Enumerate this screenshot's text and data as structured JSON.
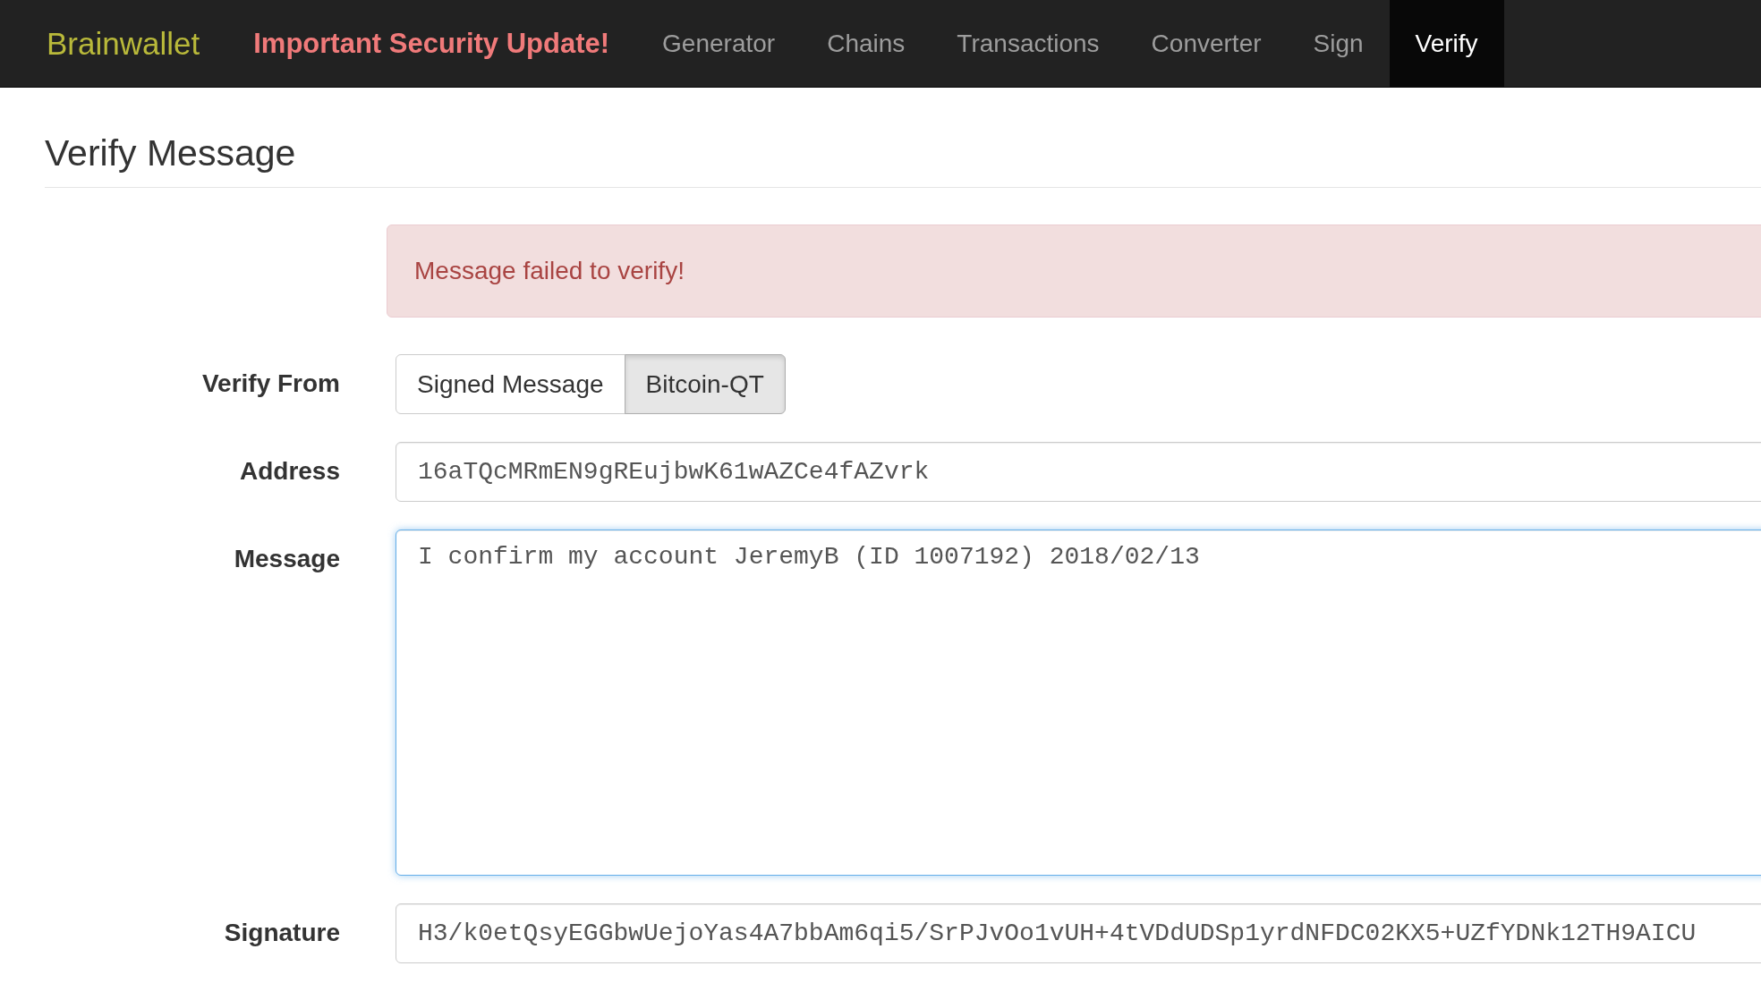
{
  "navbar": {
    "brand": "Brainwallet",
    "notice": "Important Security Update!",
    "items": [
      {
        "label": "Generator",
        "selected": false
      },
      {
        "label": "Chains",
        "selected": false
      },
      {
        "label": "Transactions",
        "selected": false
      },
      {
        "label": "Converter",
        "selected": false
      },
      {
        "label": "Sign",
        "selected": false
      },
      {
        "label": "Verify",
        "selected": true
      }
    ]
  },
  "heading": "Verify Message",
  "alert": {
    "text": "Message failed to verify!"
  },
  "form": {
    "verify_from": {
      "label": "Verify From",
      "options": [
        {
          "label": "Signed Message",
          "selected": false
        },
        {
          "label": "Bitcoin-QT",
          "selected": true
        }
      ]
    },
    "address": {
      "label": "Address",
      "value": "16aTQcMRmEN9gREujbwK61wAZCe4fAZvrk"
    },
    "message": {
      "label": "Message",
      "value": "I confirm my account JeremyB (ID 1007192) 2018/02/13",
      "focused": true
    },
    "signature": {
      "label": "Signature",
      "value": "H3/k0etQsyEGGbwUejoYas4A7bbAm6qi5/SrPJvOo1vUH+4tVDdUDSp1yrdNFDC02KX5+UZfYDNk12TH9AICU"
    }
  }
}
